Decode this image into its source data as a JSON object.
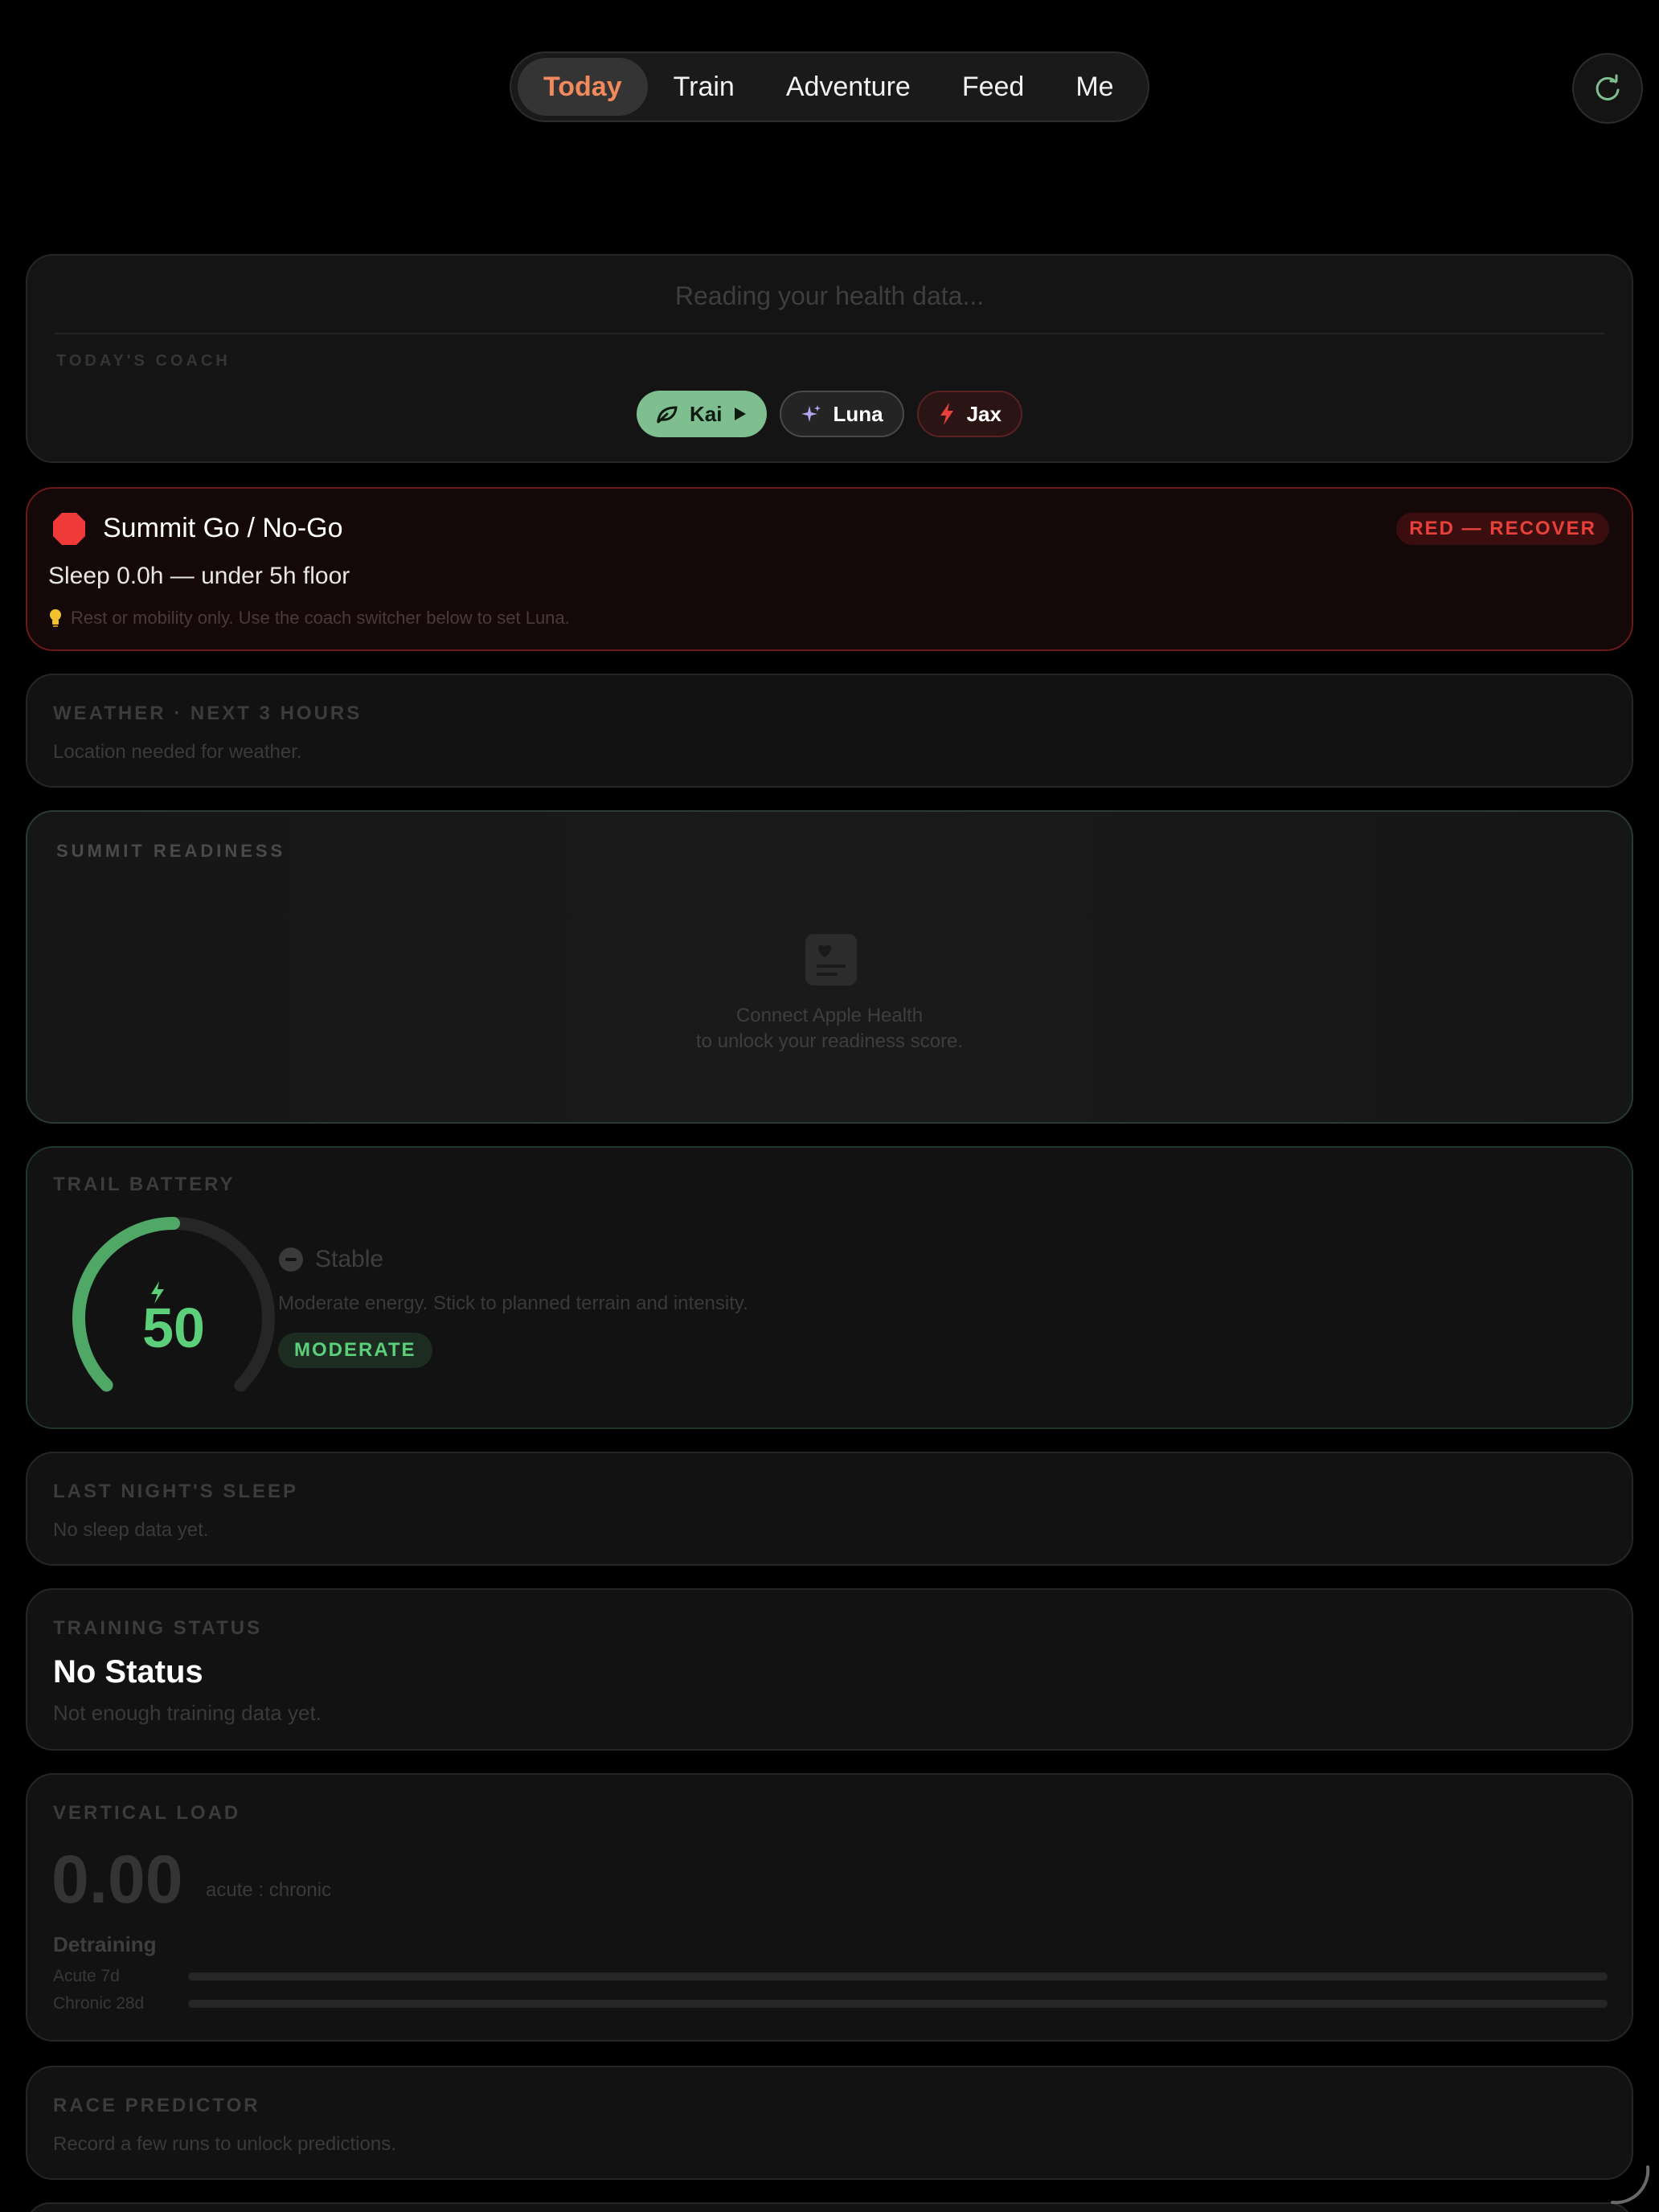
{
  "nav": {
    "tabs": [
      {
        "label": "Today",
        "active": true
      },
      {
        "label": "Train"
      },
      {
        "label": "Adventure"
      },
      {
        "label": "Feed"
      },
      {
        "label": "Me"
      }
    ],
    "refresh_icon": "refresh-icon"
  },
  "coach": {
    "reading": "Reading your health data...",
    "label": "TODAY'S COACH",
    "coaches": [
      {
        "name": "Kai",
        "icon": "leaf-icon",
        "selected": true
      },
      {
        "name": "Luna",
        "icon": "sparkle-icon"
      },
      {
        "name": "Jax",
        "icon": "bolt-icon"
      }
    ]
  },
  "summit": {
    "title": "Summit Go / No-Go",
    "badge": "RED — RECOVER",
    "subtitle": "Sleep 0.0h — under 5h floor",
    "hint": "Rest or mobility only. Use the coach switcher below to set Luna.",
    "status_color": "#e8403a"
  },
  "weather": {
    "label": "WEATHER · NEXT 3 HOURS",
    "message": "Location needed for weather."
  },
  "readiness": {
    "label": "SUMMIT READINESS",
    "line1": "Connect Apple Health",
    "line2": "to unlock your readiness score."
  },
  "battery": {
    "label": "TRAIL BATTERY",
    "value": "50",
    "level_percent": 50,
    "state": "Stable",
    "description": "Moderate energy. Stick to planned terrain and intensity.",
    "pill": "MODERATE",
    "accent": "#5ccf7a"
  },
  "sleep": {
    "label": "LAST NIGHT'S SLEEP",
    "message": "No sleep data yet."
  },
  "training": {
    "label": "TRAINING STATUS",
    "value": "No Status",
    "message": "Not enough training data yet."
  },
  "vertical_load": {
    "label": "VERTICAL LOAD",
    "value": "0.00",
    "unit": "acute : chronic",
    "status": "Detraining",
    "rows": [
      {
        "label": "Acute 7d",
        "fraction": 0
      },
      {
        "label": "Chronic 28d",
        "fraction": 0
      }
    ]
  },
  "race": {
    "label": "RACE PREDICTOR",
    "message": "Record a few runs to unlock predictions."
  }
}
